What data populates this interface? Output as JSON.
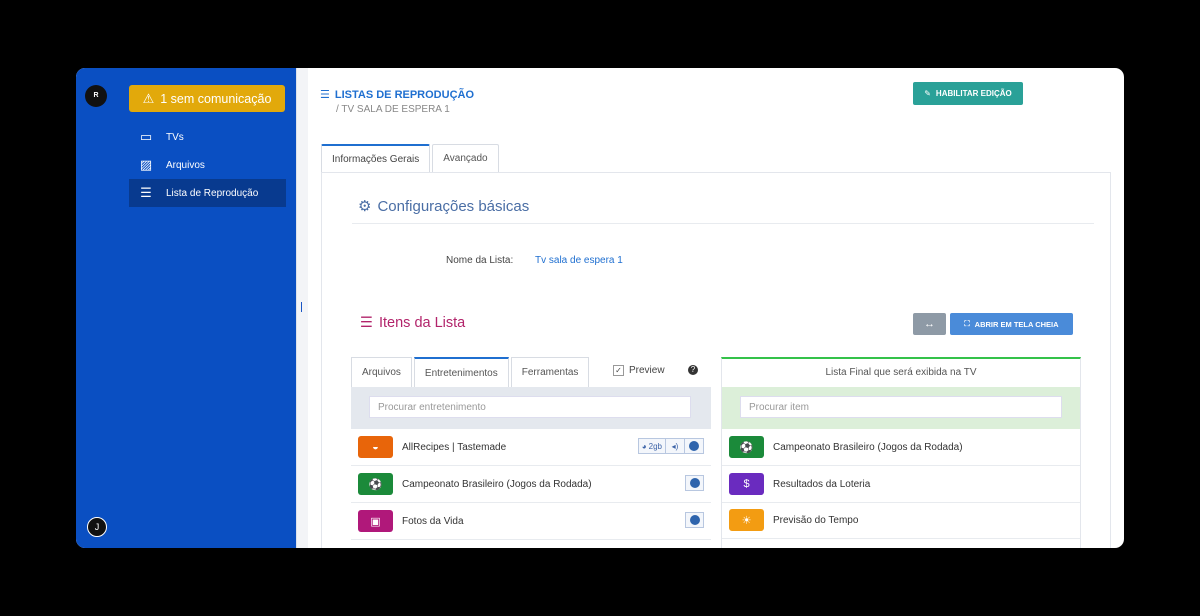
{
  "sidebar": {
    "logo_text": "R",
    "alert_label": "1 sem comunicação",
    "items": [
      {
        "label": "TVs",
        "icon": "monitor-icon"
      },
      {
        "label": "Arquivos",
        "icon": "image-icon"
      },
      {
        "label": "Lista de Reprodução",
        "icon": "list-icon",
        "active": true
      }
    ],
    "user_initial": "J"
  },
  "header": {
    "title": "LISTAS DE REPRODUÇÃO",
    "subtitle": "/ TV SALA DE ESPERA 1",
    "edit_button": "HABILITAR EDIÇÃO"
  },
  "tabs": [
    {
      "label": "Informações Gerais",
      "active": true
    },
    {
      "label": "Avançado",
      "active": false
    }
  ],
  "basic": {
    "title": "Configurações básicas",
    "name_label": "Nome da Lista:",
    "name_value": "Tv sala de espera 1"
  },
  "items_section": {
    "title": "Itens da Lista",
    "swap_button": "↔",
    "fullscreen_button": "ABRIR EM TELA CHEIA"
  },
  "left_panel": {
    "tabs": [
      {
        "label": "Arquivos",
        "active": false
      },
      {
        "label": "Entretenimentos",
        "active": true
      },
      {
        "label": "Ferramentas",
        "active": false
      }
    ],
    "preview_label": "Preview",
    "preview_checked": "✓",
    "help_glyph": "?",
    "search_placeholder": "Procurar entretenimento",
    "rows": [
      {
        "label": "AllRecipes | Tastemade",
        "color": "#e8650a",
        "icon": "bowl-icon",
        "badge_size": "2gb"
      },
      {
        "label": "Campeonato Brasileiro (Jogos da Rodada)",
        "color": "#1b8a3a",
        "icon": "soccer-ball-icon"
      },
      {
        "label": "Fotos da Vida",
        "color": "#b0187a",
        "icon": "photo-icon"
      }
    ]
  },
  "right_panel": {
    "title": "Lista Final que será exibida na TV",
    "search_placeholder": "Procurar item",
    "rows": [
      {
        "label": "Campeonato Brasileiro (Jogos da Rodada)",
        "color": "#1b8a3a",
        "icon": "soccer-ball-icon"
      },
      {
        "label": "Resultados da Loteria",
        "color": "#6a2bbf",
        "icon": "money-bag-icon"
      },
      {
        "label": "Previsão do Tempo",
        "color": "#f39c12",
        "icon": "sun-icon"
      }
    ]
  }
}
